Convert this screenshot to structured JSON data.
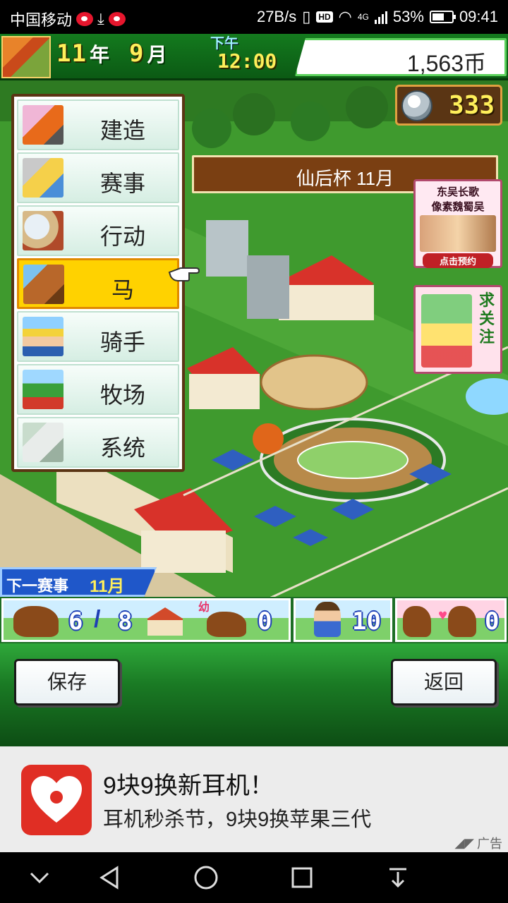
{
  "status_bar": {
    "carrier": "中国移动",
    "net_speed": "27B/s",
    "network": "4G",
    "battery": "53%",
    "time": "09:41"
  },
  "hud": {
    "year_value": "11",
    "year_unit": "年",
    "month_value": "9",
    "month_unit": "月",
    "ampm": "下午",
    "clock": "12:00",
    "money": "1,563币",
    "medals": "333"
  },
  "event_banner": "仙后杯 11月",
  "side_ads": {
    "ad1_line1": "东吴长歌",
    "ad1_line2": "像素魏蜀吴",
    "ad1_button": "点击预约",
    "ad2_text": "求关注"
  },
  "menu": {
    "items": [
      {
        "label": "建造",
        "icon": "build-icon"
      },
      {
        "label": "赛事",
        "icon": "race-icon"
      },
      {
        "label": "行动",
        "icon": "action-icon"
      },
      {
        "label": "马",
        "icon": "horse-icon",
        "active": true
      },
      {
        "label": "骑手",
        "icon": "jockey-icon"
      },
      {
        "label": "牧场",
        "icon": "ranch-icon"
      },
      {
        "label": "系统",
        "icon": "system-icon"
      }
    ]
  },
  "next_race": {
    "label": "下一赛事",
    "month": "11月"
  },
  "stats": {
    "horses": "6",
    "stable_capacity": "8",
    "youth_label": "幼",
    "foals": "0",
    "staff": "10",
    "breeding_pairs": "0"
  },
  "buttons": {
    "save": "保存",
    "back": "返回"
  },
  "ad": {
    "title": "9块9换新耳机！",
    "subtitle": "耳机秒杀节，9块9换苹果三代",
    "tag": "广告"
  },
  "colors": {
    "hud_green": "#147a1e",
    "menu_active": "#ffd200",
    "number_yellow": "#ffef5a",
    "ad_red": "#e02e24"
  }
}
